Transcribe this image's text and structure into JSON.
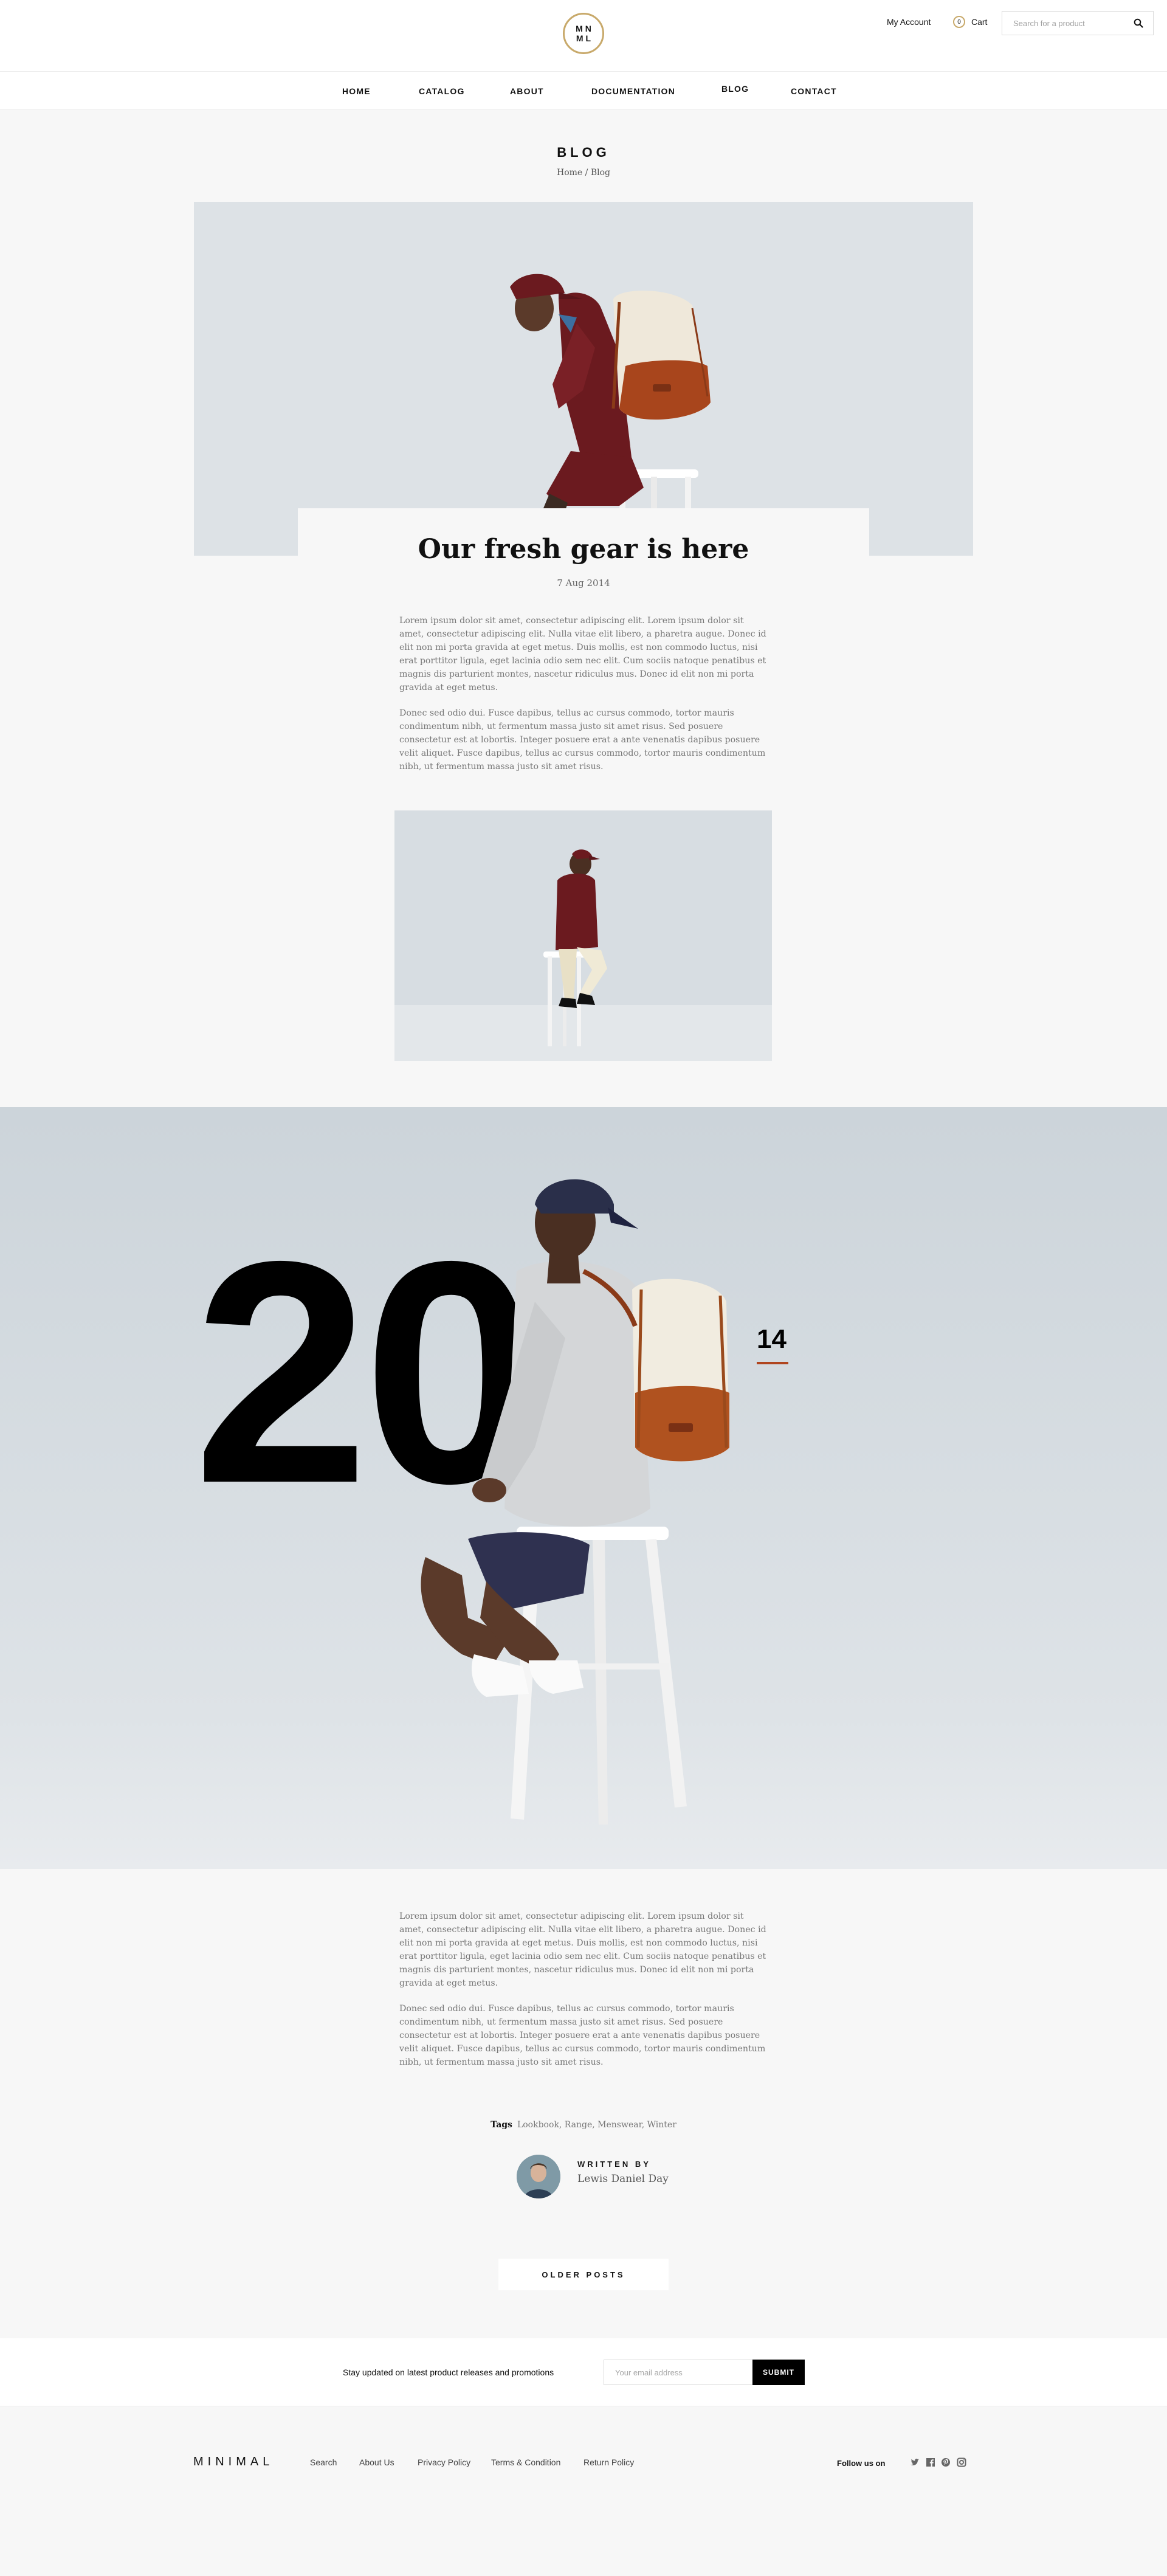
{
  "header": {
    "logo_line1": "MN",
    "logo_line2": "ML",
    "account_label": "My Account",
    "cart_label": "Cart",
    "cart_count": "0",
    "search_placeholder": "Search for a product"
  },
  "nav": {
    "items": [
      "HOME",
      "CATALOG",
      "ABOUT",
      "DOCUMENTATION",
      "BLOG",
      "CONTACT"
    ]
  },
  "page": {
    "title": "BLOG",
    "breadcrumb_home": "Home",
    "breadcrumb_sep": "/",
    "breadcrumb_current": "Blog"
  },
  "post": {
    "title": "Our fresh gear is here",
    "date": "7 Aug 2014",
    "para1": "Lorem ipsum dolor sit amet, consectetur adipiscing elit. Lorem ipsum dolor sit amet, consectetur adipiscing elit. Nulla vitae elit libero, a pharetra augue. Donec id elit non mi porta gravida at eget metus. Duis mollis, est non commodo luctus, nisi erat porttitor ligula, eget lacinia odio sem nec elit. Cum sociis natoque penatibus et magnis dis parturient montes, nascetur ridiculus mus. Donec id elit non mi porta gravida at eget metus.",
    "para2": "Donec sed odio dui. Fusce dapibus, tellus ac cursus commodo, tortor mauris condimentum nibh, ut fermentum massa justo sit amet risus. Sed posuere consectetur est at lobortis. Integer posuere erat a ante venenatis dapibus posuere velit aliquet. Fusce dapibus, tellus ac cursus commodo, tortor mauris condimentum nibh, ut fermentum massa justo sit amet risus.",
    "para3": "Lorem ipsum dolor sit amet, consectetur adipiscing elit. Lorem ipsum dolor sit amet, consectetur adipiscing elit. Nulla vitae elit libero, a pharetra augue. Donec id elit non mi porta gravida at eget metus. Duis mollis, est non commodo luctus, nisi erat porttitor ligula, eget lacinia odio sem nec elit. Cum sociis natoque penatibus et magnis dis parturient montes, nascetur ridiculus mus. Donec id elit non mi porta gravida at eget metus.",
    "para4": "Donec sed odio dui. Fusce dapibus, tellus ac cursus commodo, tortor mauris condimentum nibh, ut fermentum massa justo sit amet risus. Sed posuere consectetur est at lobortis. Integer posuere erat a ante venenatis dapibus posuere velit aliquet. Fusce dapibus, tellus ac cursus commodo, tortor mauris condimentum nibh, ut fermentum massa justo sit amet risus.",
    "year_big": "20",
    "year_small": "14",
    "tags_label": "Tags",
    "tags": "Lookbook, Range, Menswear, Winter",
    "written_by_label": "WRITTEN BY",
    "author": "Lewis Daniel Day"
  },
  "older_posts_label": "OLDER POSTS",
  "newsletter": {
    "text": "Stay updated on latest product releases and promotions",
    "placeholder": "Your email address",
    "submit_label": "SUBMIT"
  },
  "footer": {
    "brand": "MINIMAL",
    "links": [
      "Search",
      "About Us",
      "Privacy Policy",
      "Terms & Condition",
      "Return Policy"
    ],
    "follow_label": "Follow us on",
    "social_icons": [
      "twitter-icon",
      "facebook-icon",
      "pinterest-icon",
      "instagram-icon"
    ]
  },
  "colors": {
    "accent_gold": "#c8a96a",
    "accent_rust": "#b0451f",
    "background": "#f7f7f7"
  }
}
